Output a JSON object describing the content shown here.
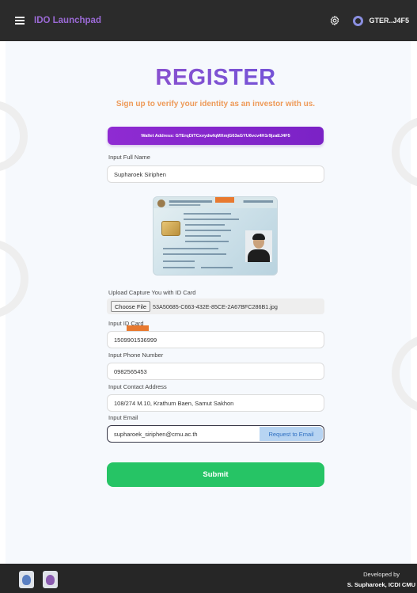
{
  "header": {
    "title": "IDO Launchpad",
    "menu_icon": "hamburger-menu-icon",
    "settings_icon": "gear-icon",
    "user_icon": "brand-logo-icon",
    "user_name": "GTER..J4F5"
  },
  "register": {
    "title": "REGISTER",
    "subtitle": "Sign up to verify your identity as an investor with us.",
    "wallet_text": "Wallet Address: GTErqDiTCxvydwfqMXmjG63aGYU6vcv4H1r9jzaEJ4F5"
  },
  "form": {
    "full_name_label": "Input Full Name",
    "full_name_value": "Supharoek Siriphen",
    "upload_label": "Upload Capture You with ID Card",
    "choose_file_label": "Choose File",
    "file_name": "53A50685-C663-432E-85CE-2A67BFC286B1.jpg",
    "id_card_label": "Input ID Card",
    "id_card_value": "1509901536999",
    "phone_label": "Input Phone Number",
    "phone_value": "0982565453",
    "address_label": "Input Contact Address",
    "address_value": "108/274 M.10, Krathum Baen, Samut Sakhon",
    "email_label": "Input Email",
    "email_value": "supharoek_siriphen@cmu.ac.th",
    "email_button": "Request to Email",
    "submit_label": "Submit"
  },
  "footer": {
    "developed_by": "Developed by",
    "developer": "S. Supharoek, ICDI CMU"
  },
  "colors": {
    "header_bg": "#2b2b2b",
    "accent_purple": "#8f2bd2",
    "title_gradient_start": "#a24ec6",
    "title_gradient_end": "#5b55e0",
    "subtitle": "#ee9a58",
    "submit_green": "#26c465",
    "redaction": "#e8792f"
  }
}
